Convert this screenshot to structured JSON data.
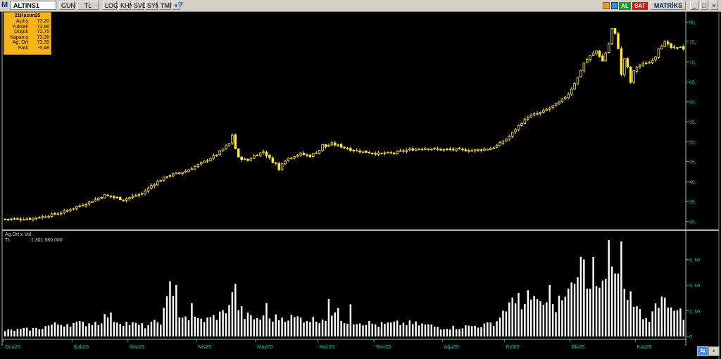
{
  "toolbar": {
    "logo": "M",
    "symbol": "ALTINS1",
    "period": "GUN",
    "currency": "TL",
    "log": "LOG",
    "khn": "KHN",
    "svd": "SVD",
    "sym": "SYM",
    "tmp": "TMP",
    "buy": "AL",
    "sell": "SAT",
    "matriks": "MATRİKS"
  },
  "info_box": {
    "date": "21Kasım25",
    "rows": [
      {
        "label": "Açılış",
        "value": "73,20"
      },
      {
        "label": "Yüksek",
        "value": "73,66"
      },
      {
        "label": "Düşük",
        "value": "72,75"
      },
      {
        "label": "Kapanış",
        "value": "73,36"
      },
      {
        "label": "Ağ. Ort",
        "value": "73,35"
      },
      {
        "label": "Fark",
        "value": "-0,48"
      }
    ]
  },
  "volume_panel": {
    "title": "Ag.Ort.x Vol",
    "unit": "TL",
    "value": ":1.301.580.000"
  },
  "colors": {
    "candle": "#ffe733",
    "volume": "#ffffff",
    "axis": "#00c0c0",
    "separator": "#9ac89a",
    "info_bg": "#f7b318"
  },
  "chart_data": [
    {
      "type": "candlestick",
      "title": "ALTINS1",
      "ylim": [
        28,
        82
      ],
      "y_ticks": [
        "30,",
        "35,",
        "40,",
        "45,",
        "50,",
        "55,",
        "60,",
        "65,",
        "70,",
        "75,",
        "80,"
      ],
      "x_ticks": [
        "Oca25",
        "Şub25",
        "Mar25",
        "Nis25",
        "May25",
        "Haz25",
        "Tem25",
        "Ağu25",
        "Eyl25",
        "Eki25",
        "Kas25"
      ],
      "x_tick_positions": [
        0,
        22,
        40,
        62,
        81,
        101,
        119,
        141,
        161,
        182,
        203
      ],
      "close_anchors": [
        [
          0,
          30.6
        ],
        [
          8,
          30.7
        ],
        [
          12,
          31.2
        ],
        [
          18,
          32.2
        ],
        [
          22,
          33.4
        ],
        [
          26,
          34.5
        ],
        [
          32,
          36.6
        ],
        [
          38,
          35.5
        ],
        [
          44,
          37.0
        ],
        [
          47,
          39.0
        ],
        [
          52,
          41.4
        ],
        [
          58,
          42.6
        ],
        [
          64,
          45.0
        ],
        [
          68,
          46.8
        ],
        [
          72,
          49.5
        ],
        [
          73,
          50.5
        ],
        [
          75,
          46.0
        ],
        [
          78,
          45.3
        ],
        [
          80,
          46.5
        ],
        [
          83,
          47.5
        ],
        [
          86,
          45.0
        ],
        [
          88,
          44.2
        ],
        [
          91,
          45.9
        ],
        [
          95,
          47.0
        ],
        [
          98,
          46.4
        ],
        [
          102,
          48.4
        ],
        [
          105,
          49.5
        ],
        [
          108,
          48.8
        ],
        [
          111,
          48.0
        ],
        [
          115,
          47.5
        ],
        [
          120,
          47.0
        ],
        [
          125,
          47.2
        ],
        [
          130,
          48.0
        ],
        [
          135,
          48.4
        ],
        [
          140,
          48.0
        ],
        [
          145,
          48.0
        ],
        [
          150,
          47.8
        ],
        [
          155,
          48.2
        ],
        [
          157,
          48.6
        ],
        [
          159,
          49.5
        ],
        [
          162,
          51.3
        ],
        [
          165,
          54.0
        ],
        [
          168,
          56.3
        ],
        [
          172,
          57.3
        ],
        [
          175,
          58.5
        ],
        [
          178,
          59.8
        ],
        [
          181,
          62.0
        ],
        [
          184,
          66.1
        ],
        [
          186,
          69.7
        ],
        [
          188,
          71.5
        ],
        [
          190,
          72.8
        ],
        [
          192,
          70.2
        ],
        [
          194,
          74.5
        ],
        [
          195,
          77.3
        ],
        [
          196,
          77.0
        ],
        [
          197,
          73.5
        ],
        [
          198,
          69.0
        ],
        [
          199,
          70.8
        ],
        [
          201,
          66.4
        ],
        [
          203,
          68.8
        ],
        [
          205,
          69.5
        ],
        [
          207,
          69.9
        ],
        [
          209,
          71.4
        ],
        [
          210,
          73.5
        ],
        [
          212,
          74.9
        ],
        [
          214,
          73.6
        ],
        [
          216,
          73.4
        ],
        [
          217,
          73.9
        ],
        [
          218,
          73.36
        ]
      ],
      "spikes": [
        [
          73,
          1.2
        ],
        [
          88,
          -1.2
        ],
        [
          102,
          0.8
        ],
        [
          195,
          1.0
        ],
        [
          198,
          -2.2
        ],
        [
          201,
          -1.5
        ]
      ]
    },
    {
      "type": "bar",
      "title": "Ag.Ort.x Vol",
      "ylim": [
        0,
        8
      ],
      "y_ticks": [
        "0",
        "2, Mr",
        "4, Mr",
        "6, Mr"
      ],
      "anchors": [
        [
          0,
          0.45
        ],
        [
          10,
          0.6
        ],
        [
          15,
          0.9
        ],
        [
          20,
          1.0
        ],
        [
          25,
          1.0
        ],
        [
          30,
          1.1
        ],
        [
          33,
          1.7
        ],
        [
          36,
          1.2
        ],
        [
          40,
          1.0
        ],
        [
          45,
          0.8
        ],
        [
          50,
          1.2
        ],
        [
          53,
          3.3
        ],
        [
          56,
          1.8
        ],
        [
          60,
          1.3
        ],
        [
          65,
          1.3
        ],
        [
          70,
          1.8
        ],
        [
          73,
          3.0
        ],
        [
          77,
          1.6
        ],
        [
          80,
          1.4
        ],
        [
          85,
          1.4
        ],
        [
          90,
          1.5
        ],
        [
          95,
          1.4
        ],
        [
          100,
          1.3
        ],
        [
          105,
          1.6
        ],
        [
          110,
          1.2
        ],
        [
          115,
          1.1
        ],
        [
          120,
          0.9
        ],
        [
          125,
          1.0
        ],
        [
          130,
          1.0
        ],
        [
          135,
          0.9
        ],
        [
          140,
          0.7
        ],
        [
          145,
          0.7
        ],
        [
          150,
          0.8
        ],
        [
          155,
          0.9
        ],
        [
          158,
          1.2
        ],
        [
          161,
          2.3
        ],
        [
          165,
          2.7
        ],
        [
          168,
          2.5
        ],
        [
          172,
          2.6
        ],
        [
          176,
          2.2
        ],
        [
          178,
          2.8
        ],
        [
          182,
          3.4
        ],
        [
          185,
          5.2
        ],
        [
          188,
          3.8
        ],
        [
          191,
          3.6
        ],
        [
          195,
          4.5
        ],
        [
          198,
          4.8
        ],
        [
          200,
          3.6
        ],
        [
          202,
          2.5
        ],
        [
          206,
          1.3
        ],
        [
          208,
          1.7
        ],
        [
          210,
          2.9
        ],
        [
          213,
          2.8
        ],
        [
          216,
          2.3
        ],
        [
          218,
          1.2
        ]
      ],
      "spikes": [
        [
          53,
          4.3
        ],
        [
          55,
          4.0
        ],
        [
          60,
          2.6
        ],
        [
          74,
          4.1
        ],
        [
          84,
          2.6
        ],
        [
          104,
          2.9
        ],
        [
          107,
          2.2
        ],
        [
          111,
          2.5
        ],
        [
          165,
          3.4
        ],
        [
          168,
          3.6
        ],
        [
          171,
          2.9
        ],
        [
          175,
          4.0
        ],
        [
          180,
          3.1
        ],
        [
          182,
          4.2
        ],
        [
          184,
          4.6
        ],
        [
          186,
          6.0
        ],
        [
          189,
          6.2
        ],
        [
          191,
          3.8
        ],
        [
          193,
          4.5
        ],
        [
          194,
          7.5
        ],
        [
          196,
          4.9
        ],
        [
          197,
          4.9
        ],
        [
          198,
          7.4
        ],
        [
          199,
          3.7
        ],
        [
          211,
          3.1
        ]
      ]
    }
  ]
}
